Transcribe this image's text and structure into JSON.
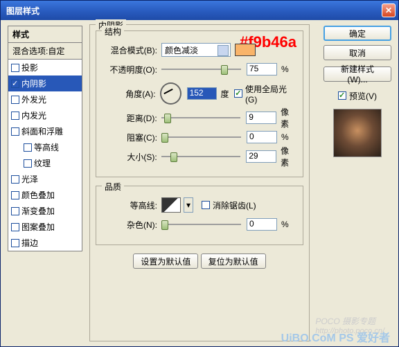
{
  "window": {
    "title": "图层样式"
  },
  "hex_annotation": "#f9b46a",
  "left_panel": {
    "header": "样式",
    "sub": "混合选项:自定",
    "items": [
      {
        "label": "投影",
        "checked": false,
        "selected": false,
        "indent": false
      },
      {
        "label": "内阴影",
        "checked": true,
        "selected": true,
        "indent": false
      },
      {
        "label": "外发光",
        "checked": false,
        "selected": false,
        "indent": false
      },
      {
        "label": "内发光",
        "checked": false,
        "selected": false,
        "indent": false
      },
      {
        "label": "斜面和浮雕",
        "checked": false,
        "selected": false,
        "indent": false
      },
      {
        "label": "等高线",
        "checked": false,
        "selected": false,
        "indent": true
      },
      {
        "label": "纹理",
        "checked": false,
        "selected": false,
        "indent": true
      },
      {
        "label": "光泽",
        "checked": false,
        "selected": false,
        "indent": false
      },
      {
        "label": "颜色叠加",
        "checked": false,
        "selected": false,
        "indent": false
      },
      {
        "label": "渐变叠加",
        "checked": false,
        "selected": false,
        "indent": false
      },
      {
        "label": "图案叠加",
        "checked": false,
        "selected": false,
        "indent": false
      },
      {
        "label": "描边",
        "checked": false,
        "selected": false,
        "indent": false
      }
    ]
  },
  "main": {
    "title": "内阴影",
    "struct": {
      "title": "结构",
      "blend_label": "混合模式(B):",
      "blend_value": "颜色减淡",
      "swatch": "#f9b46a",
      "opacity_label": "不透明度(O):",
      "opacity_value": "75",
      "opacity_unit": "%",
      "angle_label": "角度(A):",
      "angle_value": "152",
      "angle_unit": "度",
      "global_label": "使用全局光(G)",
      "distance_label": "距离(D):",
      "distance_value": "9",
      "distance_unit": "像素",
      "choke_label": "阻塞(C):",
      "choke_value": "0",
      "choke_unit": "%",
      "size_label": "大小(S):",
      "size_value": "29",
      "size_unit": "像素"
    },
    "quality": {
      "title": "品质",
      "contour_label": "等高线:",
      "aa_label": "消除锯齿(L)",
      "noise_label": "杂色(N):",
      "noise_value": "0",
      "noise_unit": "%"
    },
    "btn_default": "设置为默认值",
    "btn_reset": "复位为默认值"
  },
  "right": {
    "ok": "确定",
    "cancel": "取消",
    "new_style": "新建样式(W)...",
    "preview": "预览(V)"
  },
  "watermark": {
    "line1": "POCO 摄影专题",
    "line2": "http://photo.poco.cn/",
    "line3": "UiBO.CoM  PS 爱好者"
  }
}
